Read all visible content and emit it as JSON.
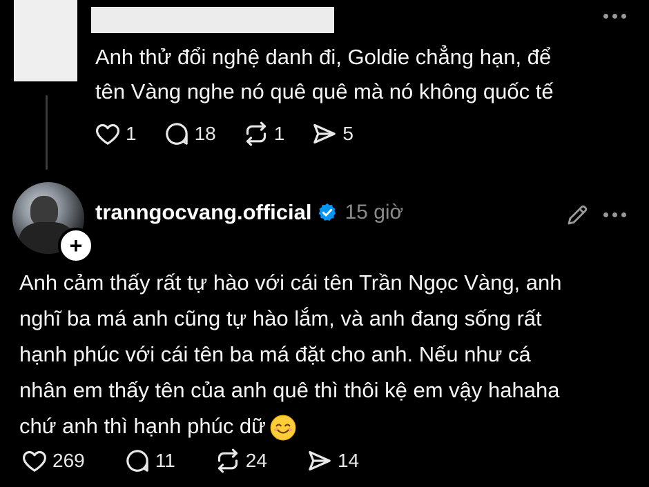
{
  "parent_comment": {
    "text_line1": "Anh thử đổi nghệ danh đi, Goldie chẳng hạn, để",
    "text_line2": "tên Vàng nghe nó quê quê mà nó không quốc tế",
    "likes": "1",
    "replies": "18",
    "reposts": "1",
    "shares": "5"
  },
  "reply": {
    "username": "tranngocvang.official",
    "time": "15 giờ",
    "follow_symbol": "+",
    "line1": "Anh cảm thấy rất tự hào với cái tên Trần Ngọc Vàng, anh",
    "line2": "nghĩ ba má anh cũng tự hào lắm, và anh đang sống rất",
    "line3": "hạnh phúc với cái tên ba má đặt cho anh. Nếu như cá",
    "line4": "nhân em thấy tên của anh quê thì thôi kệ em vậy hahaha",
    "line5": "chứ anh thì hạnh phúc dữ",
    "likes": "269",
    "replies": "11",
    "reposts": "24",
    "shares": "14"
  },
  "colors": {
    "background": "#000000",
    "text": "#f5f5f5",
    "muted": "#8a8a8a",
    "verified": "#0095f6"
  },
  "icons": [
    "heart-icon",
    "comment-icon",
    "repost-icon",
    "share-icon",
    "verified-badge-icon",
    "edit-pencil-icon",
    "more-icon",
    "smiling-face-emoji"
  ]
}
